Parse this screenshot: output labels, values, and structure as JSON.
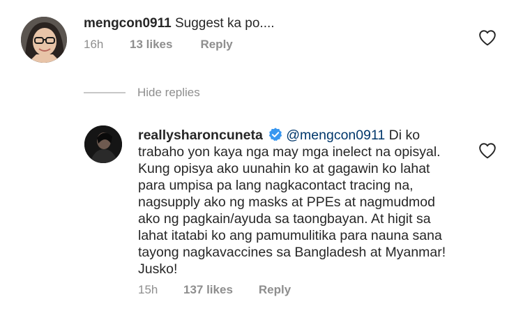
{
  "comment": {
    "username": "mengcon0911",
    "text": "Suggest ka po....",
    "time": "16h",
    "likes": "13 likes",
    "reply_label": "Reply",
    "like_icon": "heart-outline-icon"
  },
  "replies_toggle": {
    "label": "Hide replies"
  },
  "reply": {
    "username": "reallysharoncuneta",
    "verified_icon": "verified-badge-icon",
    "mention": "@mengcon0911",
    "lines": [
      " Di ko",
      "trabaho yon kaya nga may mga inelect na opisyal.",
      "Kung opisya ako uunahin ko at gagawin ko lahat",
      "para umpisa pa lang nagkacontact tracing na,",
      "nagsupply ako ng masks at PPEs at nagmudmod",
      "ako ng pagkain/ayuda sa taongbayan. At higit sa",
      "lahat itatabi ko ang pamumulitika para nauna sana",
      "tayong nagkavaccines sa Bangladesh at Myanmar!",
      "Jusko!"
    ],
    "time": "15h",
    "likes": "137 likes",
    "reply_label": "Reply",
    "like_icon": "heart-outline-icon"
  },
  "colors": {
    "text": "#262626",
    "secondary": "#8e8e8e",
    "mention": "#00376b",
    "verified": "#3897f0"
  }
}
